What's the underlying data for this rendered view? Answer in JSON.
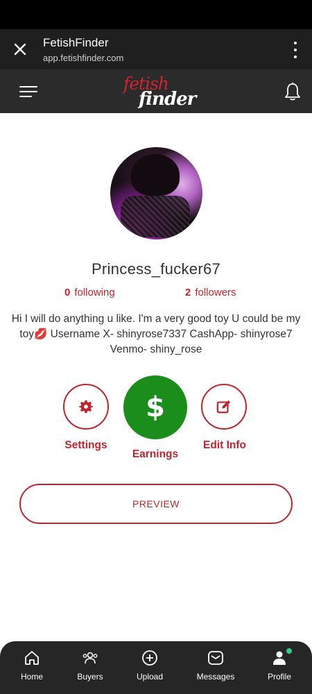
{
  "browser": {
    "title": "FetishFinder",
    "url": "app.fetishfinder.com"
  },
  "header": {
    "logo_top": "fetish",
    "logo_bottom": "finder"
  },
  "profile": {
    "username": "Princess_fucker67",
    "following_count": "0",
    "following_label": "following",
    "followers_count": "2",
    "followers_label": "followers",
    "bio_before": "Hi I will do anything u like. I'm a very good toy U could be my toy",
    "bio_emoji": "💋",
    "bio_after": " Username X- shinyrose7337 CashApp- shinyrose7 Venmo- shiny_rose"
  },
  "actions": {
    "settings_label": "Settings",
    "earnings_label": "Earnings",
    "earnings_symbol": "$",
    "edit_label": "Edit Info",
    "preview_label": "PREVIEW"
  },
  "nav": {
    "items": [
      {
        "label": "Home",
        "icon": "home-icon"
      },
      {
        "label": "Buyers",
        "icon": "users-icon"
      },
      {
        "label": "Upload",
        "icon": "plus-circle-icon"
      },
      {
        "label": "Messages",
        "icon": "message-icon"
      },
      {
        "label": "Profile",
        "icon": "profile-icon"
      }
    ]
  },
  "colors": {
    "accent": "#c0252c",
    "earnings_green": "#1a8d1a",
    "header_bg": "#2b2b2b",
    "nav_bg": "#262626",
    "online": "#2fd07e"
  }
}
